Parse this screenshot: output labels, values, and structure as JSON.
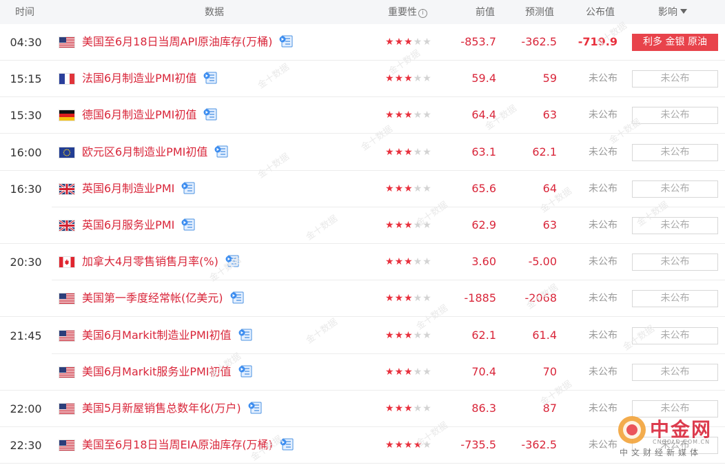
{
  "header": {
    "time": "时间",
    "data": "数据",
    "importance": "重要性",
    "info_icon": "ⓘ",
    "prev": "前值",
    "forecast": "预测值",
    "actual": "公布值",
    "impact": "影响"
  },
  "rows": [
    {
      "time": "04:30",
      "flag": "us",
      "name": "美国至6月18日当周API原油库存(万桶)",
      "stars": 3,
      "prev": "-853.7",
      "forecast": "-362.5",
      "actual": "-719.9",
      "impact": "利多 金银 原油",
      "released": true
    },
    {
      "time": "15:15",
      "flag": "fr",
      "name": "法国6月制造业PMI初值",
      "stars": 3,
      "prev": "59.4",
      "forecast": "59",
      "actual": "未公布",
      "impact": "未公布",
      "released": false
    },
    {
      "time": "15:30",
      "flag": "de",
      "name": "德国6月制造业PMI初值",
      "stars": 3,
      "prev": "64.4",
      "forecast": "63",
      "actual": "未公布",
      "impact": "未公布",
      "released": false
    },
    {
      "time": "16:00",
      "flag": "eu",
      "name": "欧元区6月制造业PMI初值",
      "stars": 3,
      "prev": "63.1",
      "forecast": "62.1",
      "actual": "未公布",
      "impact": "未公布",
      "released": false
    },
    {
      "time": "16:30",
      "flag": "gb",
      "name": "英国6月制造业PMI",
      "stars": 3,
      "prev": "65.6",
      "forecast": "64",
      "actual": "未公布",
      "impact": "未公布",
      "released": false
    },
    {
      "time": "",
      "flag": "gb",
      "name": "英国6月服务业PMI",
      "stars": 3,
      "prev": "62.9",
      "forecast": "63",
      "actual": "未公布",
      "impact": "未公布",
      "released": false
    },
    {
      "time": "20:30",
      "flag": "ca",
      "name": "加拿大4月零售销售月率(%)",
      "stars": 3,
      "prev": "3.60",
      "forecast": "-5.00",
      "actual": "未公布",
      "impact": "未公布",
      "released": false
    },
    {
      "time": "",
      "flag": "us",
      "name": "美国第一季度经常帐(亿美元)",
      "stars": 3,
      "prev": "-1885",
      "forecast": "-2068",
      "actual": "未公布",
      "impact": "未公布",
      "released": false
    },
    {
      "time": "21:45",
      "flag": "us",
      "name": "美国6月Markit制造业PMI初值",
      "stars": 3,
      "prev": "62.1",
      "forecast": "61.4",
      "actual": "未公布",
      "impact": "未公布",
      "released": false
    },
    {
      "time": "",
      "flag": "us",
      "name": "美国6月Markit服务业PMI初值",
      "stars": 3,
      "prev": "70.4",
      "forecast": "70",
      "actual": "未公布",
      "impact": "未公布",
      "released": false
    },
    {
      "time": "22:00",
      "flag": "us",
      "name": "美国5月新屋销售总数年化(万户)",
      "stars": 3,
      "prev": "86.3",
      "forecast": "87",
      "actual": "未公布",
      "impact": "未公布",
      "released": false
    },
    {
      "time": "22:30",
      "flag": "us",
      "name": "美国至6月18日当周EIA原油库存(万桶)",
      "stars": 4,
      "prev": "-735.5",
      "forecast": "-362.5",
      "actual": "未公布",
      "impact": "未公布",
      "released": false
    }
  ],
  "watermark": "金十数据",
  "logo": {
    "name": "中金网",
    "domain": "CNGOLD.COM.CN",
    "tagline": "中文财经新媒体"
  },
  "colors": {
    "accent": "#d9263a",
    "impact_hot": "#e8434b",
    "header_bg": "#f5f6f8"
  }
}
